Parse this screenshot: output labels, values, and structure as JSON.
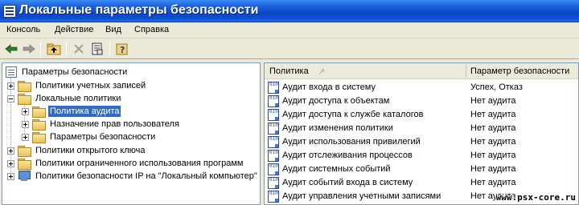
{
  "window": {
    "title": "Локальные параметры безопасности"
  },
  "menu": {
    "items": [
      "Консоль",
      "Действие",
      "Вид",
      "Справка"
    ]
  },
  "toolbar": {
    "buttons": [
      "back-arrow-icon",
      "forward-arrow-icon",
      "up-folder-icon",
      "delete-icon",
      "properties-icon",
      "help-icon"
    ]
  },
  "tree": {
    "root": "Параметры безопасности",
    "nodes": [
      {
        "label": "Политики учетных записей"
      },
      {
        "label": "Локальные политики"
      },
      {
        "label": "Политика аудита"
      },
      {
        "label": "Назначение прав пользователя"
      },
      {
        "label": "Параметры безопасности"
      },
      {
        "label": "Политики открытого ключа"
      },
      {
        "label": "Политики ограниченного использования программ"
      },
      {
        "label": "Политики безопасности IP на \"Локальный компьютер\""
      }
    ]
  },
  "list": {
    "col_policy": "Политика",
    "col_setting": "Параметр безопасности",
    "rows": [
      {
        "policy": "Аудит входа в систему",
        "setting": "Успех, Отказ"
      },
      {
        "policy": "Аудит доступа к объектам",
        "setting": "Нет аудита"
      },
      {
        "policy": "Аудит доступа к службе каталогов",
        "setting": "Нет аудита"
      },
      {
        "policy": "Аудит изменения политики",
        "setting": "Нет аудита"
      },
      {
        "policy": "Аудит использования привилегий",
        "setting": "Нет аудита"
      },
      {
        "policy": "Аудит отслеживания процессов",
        "setting": "Нет аудита"
      },
      {
        "policy": "Аудит системных событий",
        "setting": "Нет аудита"
      },
      {
        "policy": "Аудит событий входа в систему",
        "setting": "Нет аудита"
      },
      {
        "policy": "Аудит управления учетными записями",
        "setting": "Нет аудита"
      }
    ]
  },
  "watermark": "www.psx-core.ru"
}
